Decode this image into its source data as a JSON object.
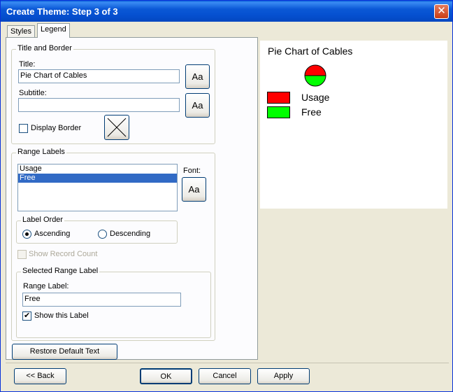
{
  "window": {
    "title": "Create Theme: Step 3 of 3",
    "close_glyph": "✕"
  },
  "tabs": [
    {
      "label": "Styles"
    },
    {
      "label": "Legend"
    }
  ],
  "title_border": {
    "group_label": "Title and Border",
    "title_label": "Title:",
    "title_value": "Pie Chart of Cables",
    "subtitle_label": "Subtitle:",
    "subtitle_value": "",
    "font_button": "Aa",
    "display_border_label": "Display Border"
  },
  "range_labels": {
    "group_label": "Range Labels",
    "items": [
      {
        "label": "Usage"
      },
      {
        "label": "Free"
      }
    ],
    "font_label": "Font:",
    "font_button": "Aa",
    "label_order": {
      "group_label": "Label Order",
      "ascending": "Ascending",
      "descending": "Descending"
    },
    "show_record_count": "Show Record Count",
    "selected": {
      "group_label": "Selected Range Label",
      "range_label_caption": "Range Label:",
      "range_label_value": "Free",
      "show_label": "Show this Label"
    },
    "restore_button": "Restore Default Text"
  },
  "preview": {
    "title": "Pie Chart of Cables",
    "legend": [
      {
        "label": "Usage",
        "color": "#ff0000"
      },
      {
        "label": "Free",
        "color": "#00ff00"
      }
    ]
  },
  "footer": {
    "back": "<< Back",
    "ok": "OK",
    "cancel": "Cancel",
    "apply": "Apply"
  }
}
